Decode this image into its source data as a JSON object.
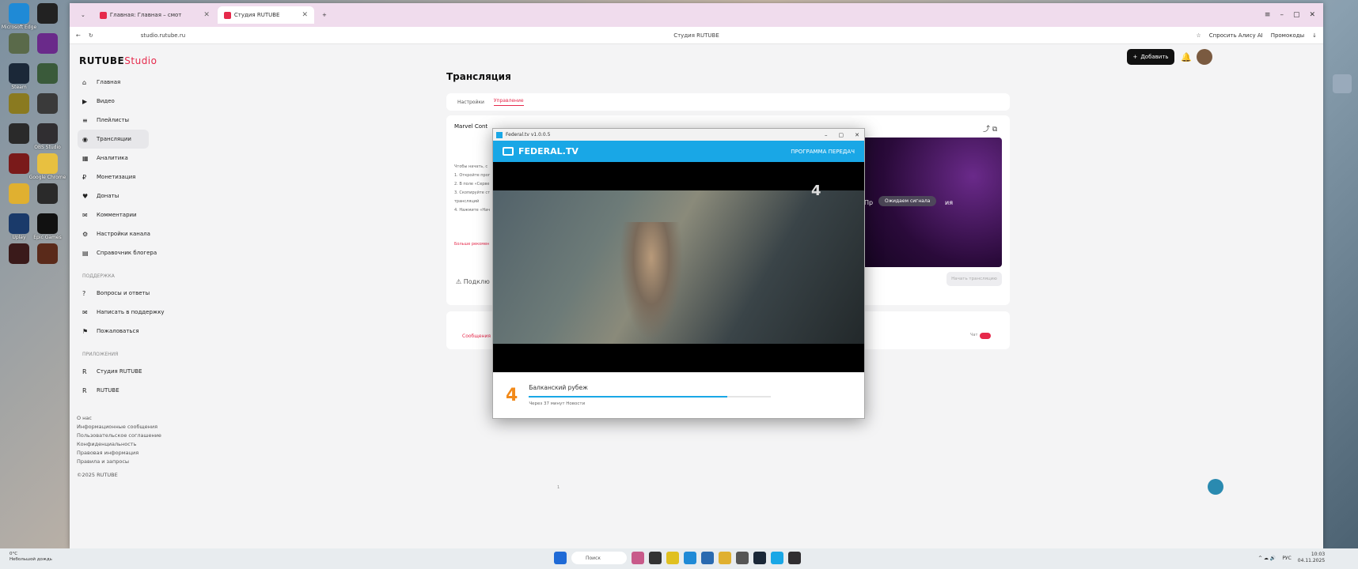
{
  "desktop": {
    "icons_left": [
      {
        "label": "Microsoft Edge",
        "color": "#1f8ad6"
      },
      {
        "label": "",
        "color": "#222"
      },
      {
        "label": "",
        "color": "#5a6a4a"
      },
      {
        "label": "",
        "color": "#6a2a8a"
      },
      {
        "label": "Steam",
        "color": "#1b2838"
      },
      {
        "label": "",
        "color": "#3a5a3a"
      },
      {
        "label": "",
        "color": "#8a7a20"
      },
      {
        "label": "",
        "color": "#3a3a3a"
      },
      {
        "label": "",
        "color": "#2a2a2a"
      },
      {
        "label": "OBS Studio",
        "color": "#302e31"
      },
      {
        "label": "",
        "color": "#7a1a1a"
      },
      {
        "label": "Google Chrome",
        "color": "#e8c040"
      },
      {
        "label": "",
        "color": "#e0b030"
      },
      {
        "label": "",
        "color": "#2a2a2a"
      },
      {
        "label": "Uplay",
        "color": "#1a3a6a"
      },
      {
        "label": "Epic Games",
        "color": "#111"
      },
      {
        "label": "",
        "color": "#3a1a1a"
      },
      {
        "label": "",
        "color": "#5a2a1a"
      }
    ],
    "icons_right": [
      {
        "label": ""
      },
      {
        "label": ""
      }
    ]
  },
  "browser": {
    "tabs": [
      {
        "title": "",
        "active": false
      },
      {
        "title": "Главная: Главная – смот",
        "active": false
      },
      {
        "title": "Студия RUTUBE",
        "active": true
      }
    ],
    "url": "studio.rutube.ru",
    "page_title": "Студия RUTUBE",
    "ask_alice": "Спросить Алису AI",
    "promocodes": "Промокоды"
  },
  "studio": {
    "logo_main": "RUTUBE",
    "logo_studio": "Studio",
    "add_button": "Добавить",
    "nav": [
      {
        "label": "Главная",
        "icon": "home-icon"
      },
      {
        "label": "Видео",
        "icon": "video-icon"
      },
      {
        "label": "Плейлисты",
        "icon": "playlist-icon"
      },
      {
        "label": "Трансляции",
        "icon": "broadcast-icon",
        "active": true
      },
      {
        "label": "Аналитика",
        "icon": "analytics-icon"
      },
      {
        "label": "Монетизация",
        "icon": "money-icon"
      },
      {
        "label": "Донаты",
        "icon": "donate-icon"
      },
      {
        "label": "Комментарии",
        "icon": "comments-icon"
      },
      {
        "label": "Настройки канала",
        "icon": "settings-icon"
      },
      {
        "label": "Справочник блогера",
        "icon": "book-icon"
      }
    ],
    "support_title": "ПОДДЕРЖКА",
    "support": [
      {
        "label": "Вопросы и ответы",
        "icon": "question-icon"
      },
      {
        "label": "Написать в поддержку",
        "icon": "mail-icon"
      },
      {
        "label": "Пожаловаться",
        "icon": "flag-icon"
      }
    ],
    "apps_title": "ПРИЛОЖЕНИЯ",
    "apps": [
      {
        "label": "Студия RUTUBE",
        "icon": "studio-icon"
      },
      {
        "label": "RUTUBE",
        "icon": "rutube-icon"
      }
    ],
    "footer": [
      "О нас",
      "Информационные сообщения",
      "Пользовательское соглашение",
      "Конфиденциальность",
      "Правовая информация",
      "Правила и запросы",
      "©2025 RUTUBE"
    ],
    "heading": "Трансляция",
    "tabs": [
      {
        "label": "Настройки"
      },
      {
        "label": "Управление",
        "active": true
      }
    ],
    "stream_title": "Marvel Cont",
    "steps": [
      "Чтобы начать, с",
      "1. Откройте прог",
      "2. В поле «Серве",
      "3. Скопируйте ст",
      "трансляций",
      "4. Нажмите «Нач"
    ],
    "more_link": "Больше рекомен",
    "connect_text": "Подклю",
    "preview_left": "Пр",
    "preview_right": "ия",
    "waiting_signal": "Ожидаем сигнала",
    "start_button": "Начать трансляцию",
    "messages_tab": "Сообщения",
    "toggle_label": "Чат",
    "pager": "1"
  },
  "federal_app": {
    "window_title": "Federal.tv v1.0.0.5",
    "brand": "FEDERAL.TV",
    "program_button": "ПРОГРАММА ПЕРЕДАЧ",
    "channel_logo": "4",
    "show_title": "Балканский рубеж",
    "next_info": "Через 37 минут  Новости",
    "progress": 0.82
  },
  "taskbar": {
    "weather": [
      "0°C",
      "Небольшой дождь"
    ],
    "search_placeholder": "Поиск",
    "lang": "РУС",
    "time": "10:03",
    "date": "04.11.2025"
  },
  "colors": {
    "accent": "#e6294b",
    "federal": "#19a7e6"
  }
}
